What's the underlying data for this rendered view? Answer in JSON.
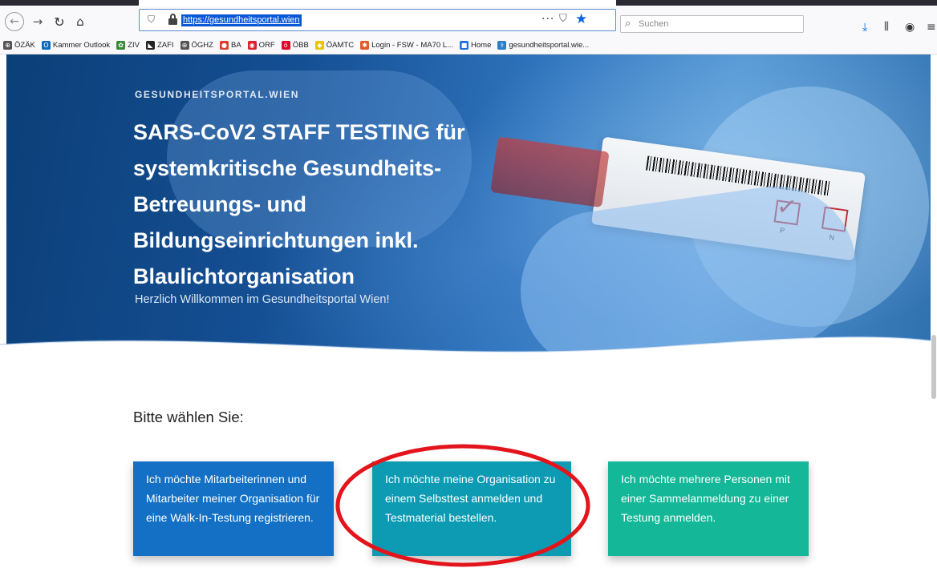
{
  "browser": {
    "url": "https://gesundheitsportal.wien",
    "search_placeholder": "Suchen",
    "icons": [
      "back-icon",
      "forward-icon",
      "reload-icon",
      "home-icon",
      "shield-icon",
      "lock-icon",
      "more-icon",
      "pocket-icon",
      "bookmark-star-icon",
      "search-icon",
      "download-icon",
      "library-icon",
      "account-icon",
      "menu-icon"
    ]
  },
  "bookmarks": [
    {
      "label": "ÖZÄK",
      "color": "#555555",
      "glyph": "⊕"
    },
    {
      "label": "Kammer Outlook",
      "color": "#0f6cbd",
      "glyph": "O"
    },
    {
      "label": "ZIV",
      "color": "#3a8a3a",
      "glyph": "✿"
    },
    {
      "label": "ZAFI",
      "color": "#222222",
      "glyph": "◣"
    },
    {
      "label": "ÖGHZ",
      "color": "#555555",
      "glyph": "⊕"
    },
    {
      "label": "BA",
      "color": "#d9402b",
      "glyph": "●"
    },
    {
      "label": "ORF",
      "color": "#d9202b",
      "glyph": "◉"
    },
    {
      "label": "ÖBB",
      "color": "#e2002a",
      "glyph": "ö"
    },
    {
      "label": "ÖAMTC",
      "color": "#e8c500",
      "glyph": "◆"
    },
    {
      "label": "Login - FSW - MA70 L...",
      "color": "#e05a2a",
      "glyph": "✱"
    },
    {
      "label": "Home",
      "color": "#1f6fd6",
      "glyph": "■"
    },
    {
      "label": "gesundheitsportal.wie...",
      "color": "#2a7fc9",
      "glyph": "⚕"
    }
  ],
  "hero": {
    "brand": "GESUNDHEITSPORTAL.WIEN",
    "title_lines": [
      "SARS-CoV2 STAFF TESTING für",
      "systemkritische Gesundheits-",
      "Betreuungs- und",
      "Bildungseinrichtungen inkl.",
      "Blaulichtorganisation"
    ],
    "subtitle": "Herzlich Willkommen im Gesundheitsportal Wien!",
    "label_p": "P",
    "label_n": "N"
  },
  "content": {
    "prompt": "Bitte wählen Sie:",
    "options": [
      {
        "label": "Ich möchte Mitarbeiterinnen und Mitarbeiter meiner Organisation für eine Walk-In-Testung registrieren.",
        "color": "#1470c4"
      },
      {
        "label": "Ich möchte meine Organisation zu einem Selbsttest anmelden und Testmaterial bestellen.",
        "color": "#0c9bb3"
      },
      {
        "label": "Ich möchte mehrere Personen mit einer Sammelanmeldung zu einer Testung anmelden.",
        "color": "#14b797"
      }
    ],
    "highlight_color": "#e3141c"
  }
}
